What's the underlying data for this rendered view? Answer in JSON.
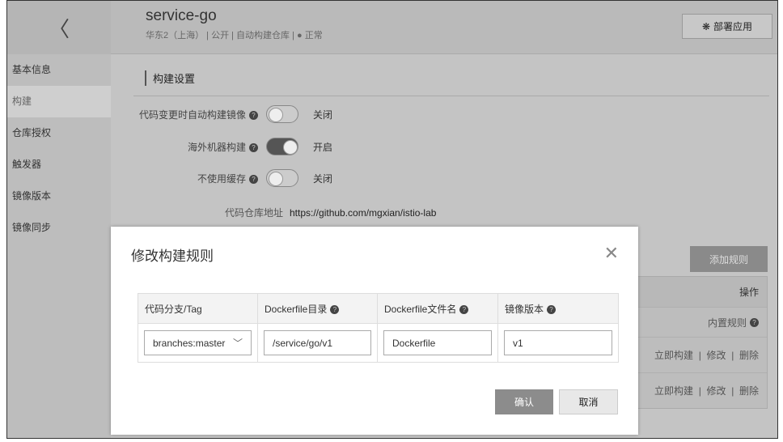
{
  "sidebar": {
    "back": "〈",
    "items": [
      "基本信息",
      "构建",
      "仓库授权",
      "触发器",
      "镜像版本",
      "镜像同步"
    ]
  },
  "header": {
    "title": "service-go",
    "subtitle": "华东2（上海） | 公开 | 自动构建仓库 | ● 正常",
    "deploy_icon": "❋",
    "deploy": "部署应用"
  },
  "main": {
    "section": "构建设置",
    "settings": [
      {
        "label": "代码变更时自动构建镜像",
        "state": "关闭",
        "on": false
      },
      {
        "label": "海外机器构建",
        "state": "开启",
        "on": true
      },
      {
        "label": "不使用缓存",
        "state": "关闭",
        "on": false
      }
    ],
    "repo_label": "代码仓库地址",
    "repo_url": "https://github.com/mgxian/istio-lab",
    "add_rule": "添加规则",
    "ops_header": "操作",
    "builtin": "内置规则",
    "actions": {
      "build": "立即构建",
      "edit": "修改",
      "delete": "删除",
      "sep": "|"
    }
  },
  "modal": {
    "title": "修改构建规则",
    "close": "✕",
    "columns": [
      "代码分支/Tag",
      "Dockerfile目录",
      "Dockerfile文件名",
      "镜像版本"
    ],
    "branch": "branches:master",
    "dir": "/service/go/v1",
    "file": "Dockerfile",
    "version": "v1",
    "confirm": "确认",
    "cancel": "取消"
  }
}
